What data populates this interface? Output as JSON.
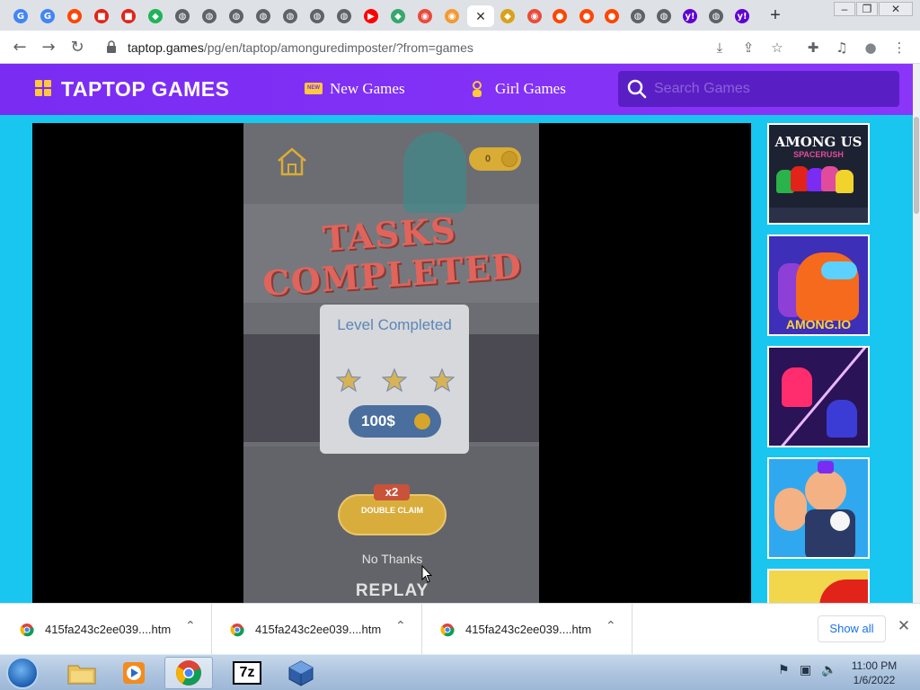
{
  "browser": {
    "tabs": [
      {
        "icon": "google-icon",
        "glyph": "G",
        "color": "#4285f4"
      },
      {
        "icon": "google-icon",
        "glyph": "G",
        "color": "#4285f4"
      },
      {
        "icon": "reddit-icon",
        "glyph": "●",
        "color": "#ff4500"
      },
      {
        "icon": "roblox-icon",
        "glyph": "■",
        "color": "#e2231a"
      },
      {
        "icon": "roblox-icon",
        "glyph": "■",
        "color": "#e2231a"
      },
      {
        "icon": "green-app-icon",
        "glyph": "◆",
        "color": "#20b35a"
      },
      {
        "icon": "globe-icon",
        "glyph": "◍",
        "color": "#5f6368"
      },
      {
        "icon": "globe-icon",
        "glyph": "◍",
        "color": "#5f6368"
      },
      {
        "icon": "globe-icon",
        "glyph": "◍",
        "color": "#5f6368"
      },
      {
        "icon": "globe-icon",
        "glyph": "◍",
        "color": "#5f6368"
      },
      {
        "icon": "globe-icon",
        "glyph": "◍",
        "color": "#5f6368"
      },
      {
        "icon": "globe-icon",
        "glyph": "◍",
        "color": "#5f6368"
      },
      {
        "icon": "globe-icon",
        "glyph": "◍",
        "color": "#5f6368"
      },
      {
        "icon": "youtube-icon",
        "glyph": "▶",
        "color": "#ff0000"
      },
      {
        "icon": "cat-game-icon",
        "glyph": "◆",
        "color": "#35a86b"
      },
      {
        "icon": "red-circle-icon",
        "glyph": "◉",
        "color": "#e84b3c"
      },
      {
        "icon": "orange-game-icon",
        "glyph": "◉",
        "color": "#f29a33"
      },
      {
        "icon": "close-icon",
        "glyph": "✕",
        "color": "#333333",
        "active": true
      },
      {
        "icon": "game-badge-icon",
        "glyph": "◆",
        "color": "#d9a21a"
      },
      {
        "icon": "red-circle-icon",
        "glyph": "◉",
        "color": "#e84b3c"
      },
      {
        "icon": "reddit-icon",
        "glyph": "●",
        "color": "#ff4500"
      },
      {
        "icon": "reddit-icon",
        "glyph": "●",
        "color": "#ff4500"
      },
      {
        "icon": "reddit-icon",
        "glyph": "●",
        "color": "#ff4500"
      },
      {
        "icon": "globe-icon",
        "glyph": "◍",
        "color": "#5f6368"
      },
      {
        "icon": "globe-icon",
        "glyph": "◍",
        "color": "#5f6368"
      },
      {
        "icon": "yahoo-icon",
        "glyph": "y!",
        "color": "#6001d2"
      },
      {
        "icon": "globe-icon",
        "glyph": "◍",
        "color": "#5f6368"
      },
      {
        "icon": "yahoo-icon",
        "glyph": "y!",
        "color": "#6001d2"
      }
    ],
    "new_tab": "+",
    "window_controls": {
      "minimize": "–",
      "maximize": "❐",
      "close": "✕"
    },
    "nav": {
      "back": "←",
      "forward": "→",
      "reload": "↻"
    },
    "url": {
      "host": "taptop.games",
      "path": "/pg/en/taptop/amonguredimposter/?from=games"
    },
    "toolbar_icons": {
      "download": "⤓",
      "share": "⇪",
      "bookmark": "☆",
      "extensions": "✚",
      "media": "♫",
      "profile": "●",
      "menu": "⋮"
    }
  },
  "site": {
    "logo": "TAPTOP GAMES",
    "nav": [
      {
        "label": "New Games",
        "badge": "NEW"
      },
      {
        "label": "Girl Games"
      }
    ],
    "search_placeholder": "Search Games",
    "accent": "#7a2cf3",
    "background": "#19c6f0"
  },
  "game": {
    "coins": "0",
    "tasks_title": "TASKS COMPLETED",
    "level_title": "Level Completed",
    "stars": 3,
    "reward": "100$",
    "multiplier": "x2",
    "double_claim": "DOUBLE CLAIM",
    "no_thanks": "No Thanks",
    "replay": "REPLAY"
  },
  "sidebar_games": [
    {
      "label": "AMONG US",
      "sublabel": "SPACERUSH",
      "bg": "#1d2233"
    },
    {
      "label": "AMONG.IO",
      "bg": "#3d2fb8"
    },
    {
      "label": "",
      "bg": "#2a1356"
    },
    {
      "label": "",
      "bg": "#2fa8f0"
    },
    {
      "label": "",
      "bg": "#f2d64b"
    }
  ],
  "downloads": {
    "items": [
      {
        "name": "415fa243c2ee039....htm"
      },
      {
        "name": "415fa243c2ee039....htm"
      },
      {
        "name": "415fa243c2ee039....htm"
      }
    ],
    "show_all": "Show all",
    "close": "✕"
  },
  "taskbar": {
    "apps": [
      {
        "name": "explorer"
      },
      {
        "name": "media-player"
      },
      {
        "name": "chrome",
        "active": true
      },
      {
        "name": "7zip",
        "label": "7z"
      },
      {
        "name": "virtualbox"
      }
    ],
    "time": "11:00 PM",
    "date": "1/6/2022"
  }
}
